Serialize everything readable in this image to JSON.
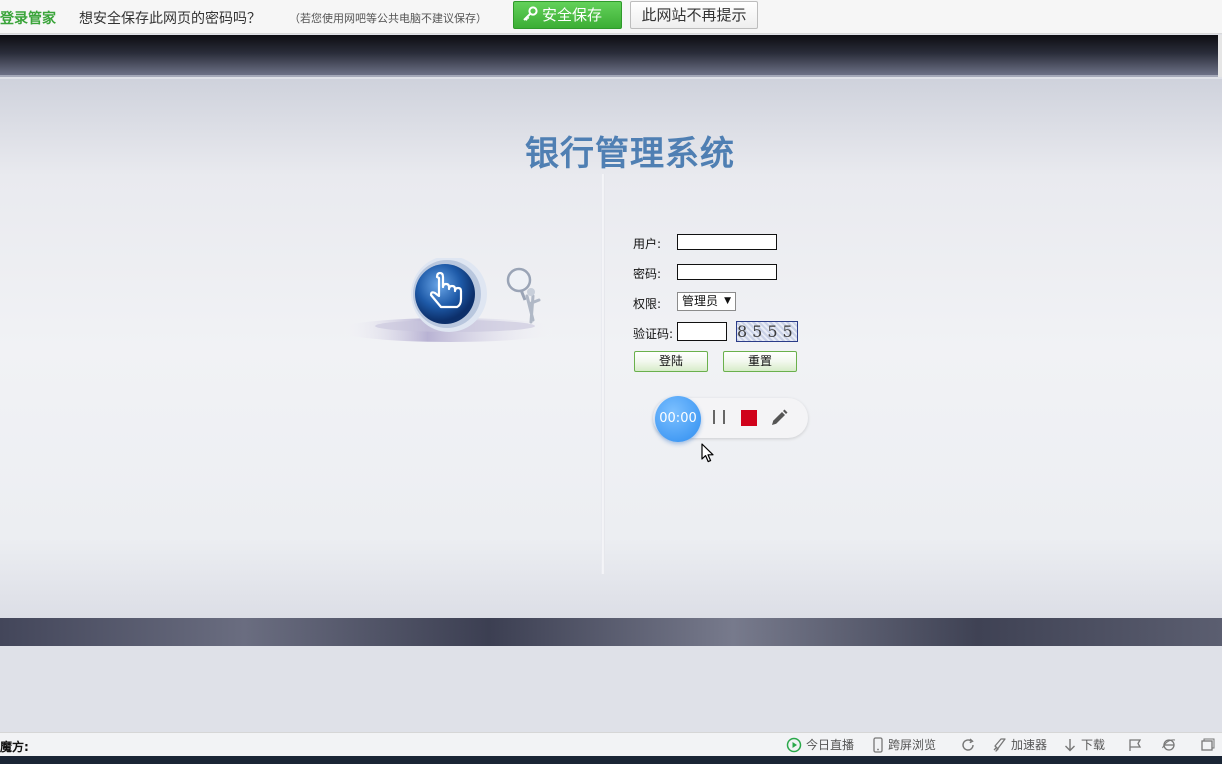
{
  "password_bar": {
    "brand": "登录管家",
    "prompt": "想安全保存此网页的密码吗？",
    "hint": "（若您使用网吧等公共电脑不建议保存）",
    "save_button": "安全保存",
    "never_button": "此网站不再提示",
    "save_icon": "key-icon"
  },
  "page": {
    "title": "银行管理系统"
  },
  "login_form": {
    "user_label": "用户:",
    "user_value": "",
    "password_label": "密码:",
    "password_value": "",
    "role_label": "权限:",
    "role_selected": "管理员",
    "captcha_label": "验证码:",
    "captcha_value": "",
    "captcha_image_text": "8555",
    "login_button": "登陆",
    "reset_button": "重置"
  },
  "recorder": {
    "timer": "00:00",
    "pause_icon": "pause-icon",
    "stop_icon": "stop-icon",
    "pen_icon": "pen-icon"
  },
  "status_bar": {
    "left_label": "魔方:",
    "items": [
      {
        "label": "今日直播",
        "icon": "play-circle-icon"
      },
      {
        "label": "跨屏浏览",
        "icon": "phone-icon"
      },
      {
        "label": "",
        "icon": "refresh-icon"
      },
      {
        "label": "加速器",
        "icon": "rocket-icon"
      },
      {
        "label": "下载",
        "icon": "download-icon"
      },
      {
        "label": "",
        "icon": "flag-icon"
      },
      {
        "label": "",
        "icon": "ie-icon"
      },
      {
        "label": "",
        "icon": "window-icon"
      }
    ],
    "accent": "#2aa84a"
  },
  "colors": {
    "title": "#4f7fb3",
    "save_button": "#3cae35",
    "stop": "#d0021b",
    "timer": "#2e8df0"
  }
}
